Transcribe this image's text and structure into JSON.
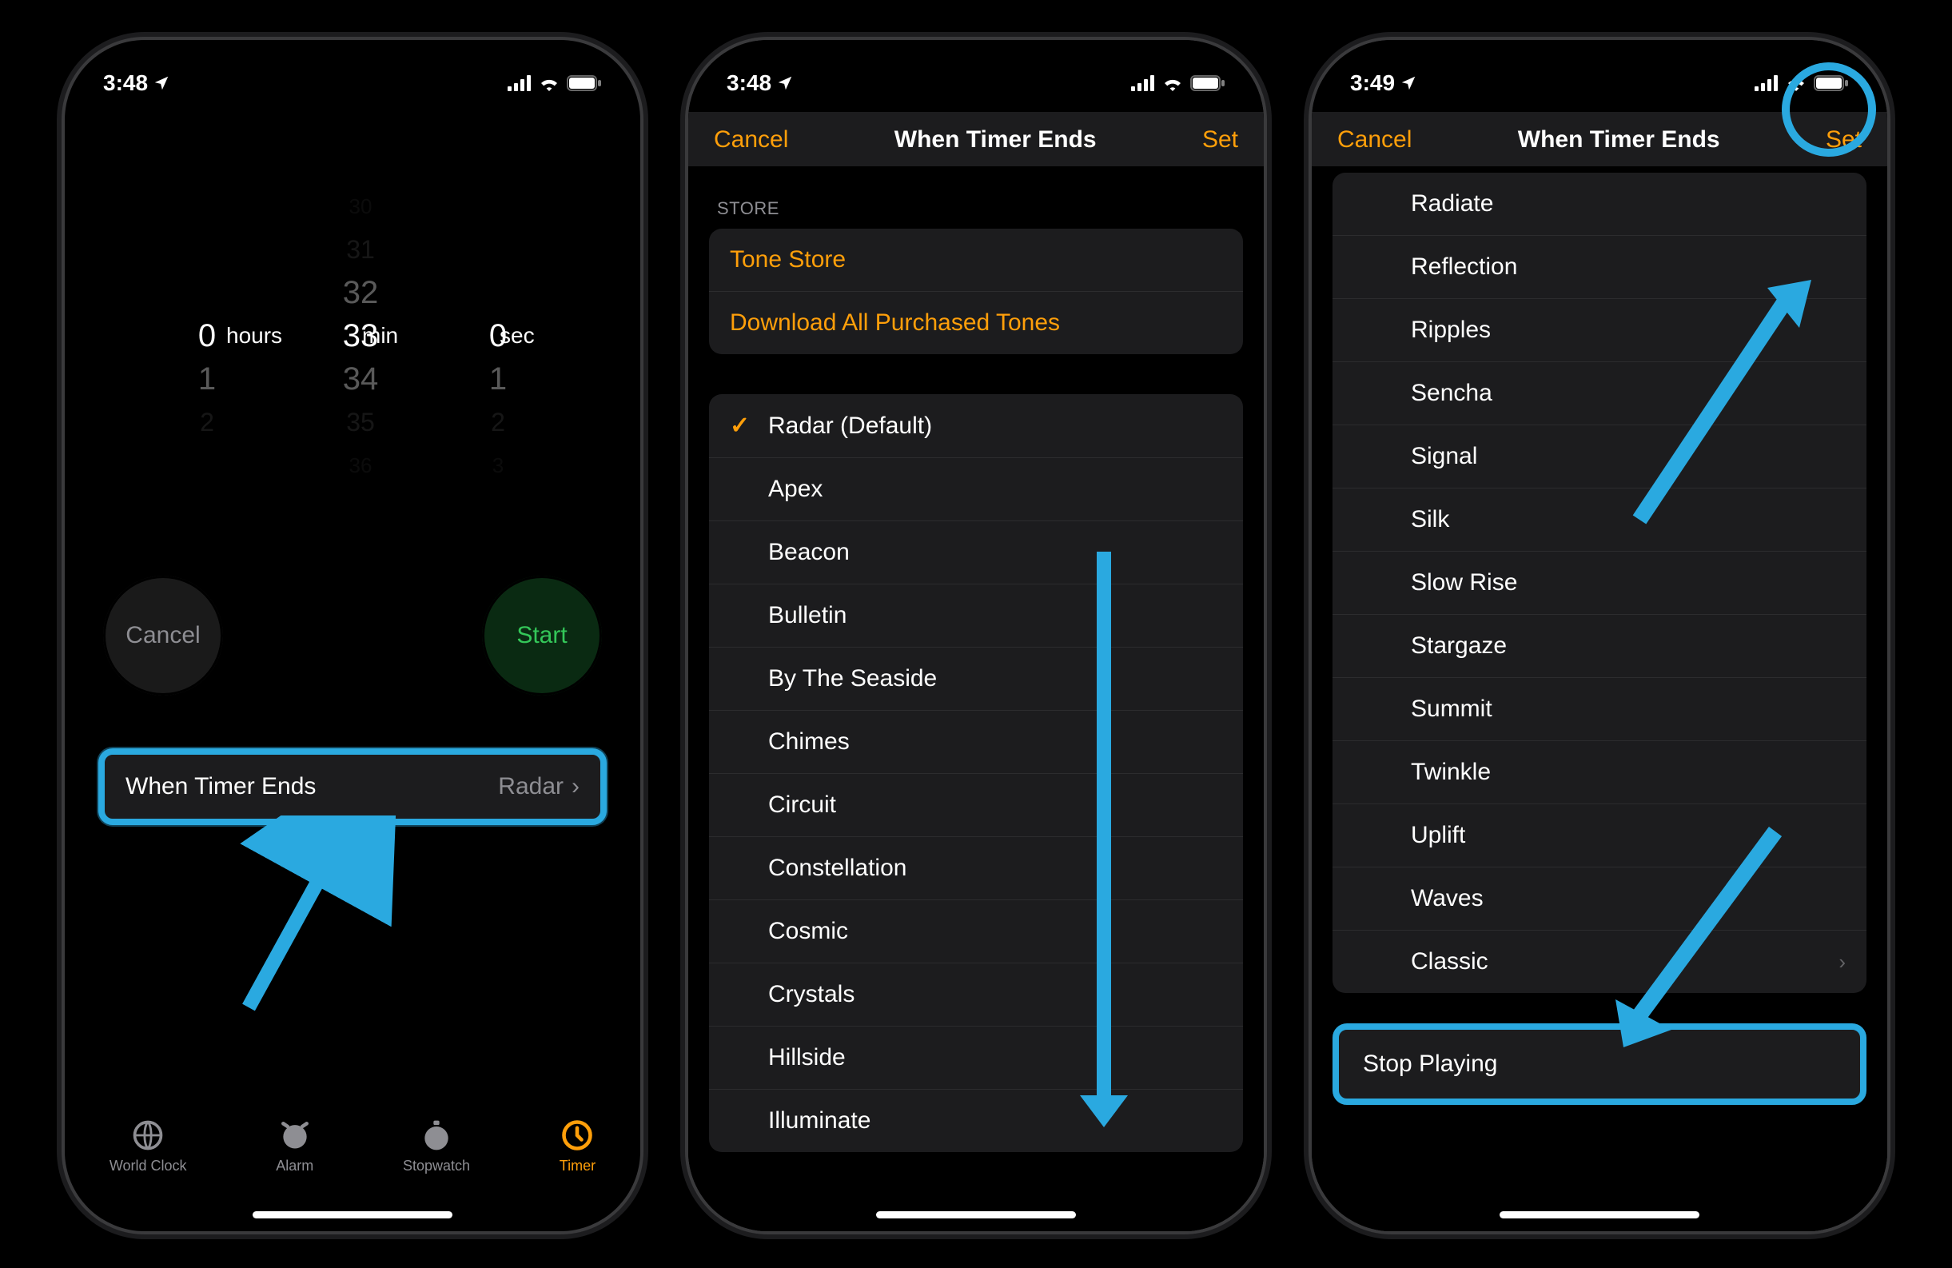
{
  "status": {
    "time_a": "3:48",
    "time_b": "3:48",
    "time_c": "3:49"
  },
  "phone1": {
    "picker": {
      "hours": "0",
      "hours_label": "hours",
      "min_prev2": "30",
      "min_prev1": "31",
      "min_prev0": "32",
      "min_sel": "33",
      "min_next0": "34",
      "min_next1": "35",
      "min_next2": "36",
      "min_label": "min",
      "sec_sel": "0",
      "sec_next0": "1",
      "sec_next1": "2",
      "sec_next2": "3",
      "sec_label": "sec",
      "h_next0": "1",
      "h_next1": "2"
    },
    "cancel": "Cancel",
    "start": "Start",
    "when_ends_label": "When Timer Ends",
    "when_ends_value": "Radar",
    "tabs": {
      "world": "World Clock",
      "alarm": "Alarm",
      "stopwatch": "Stopwatch",
      "timer": "Timer"
    }
  },
  "phone2": {
    "nav_cancel": "Cancel",
    "nav_title": "When Timer Ends",
    "nav_set": "Set",
    "store_header": "STORE",
    "store_tone": "Tone Store",
    "store_download": "Download All Purchased Tones",
    "tones": [
      "Radar (Default)",
      "Apex",
      "Beacon",
      "Bulletin",
      "By The Seaside",
      "Chimes",
      "Circuit",
      "Constellation",
      "Cosmic",
      "Crystals",
      "Hillside",
      "Illuminate"
    ]
  },
  "phone3": {
    "nav_cancel": "Cancel",
    "nav_title": "When Timer Ends",
    "nav_set": "Set",
    "tones": [
      "Radiate",
      "Reflection",
      "Ripples",
      "Sencha",
      "Signal",
      "Silk",
      "Slow Rise",
      "Stargaze",
      "Summit",
      "Twinkle",
      "Uplift",
      "Waves",
      "Classic"
    ],
    "stop_playing": "Stop Playing"
  }
}
